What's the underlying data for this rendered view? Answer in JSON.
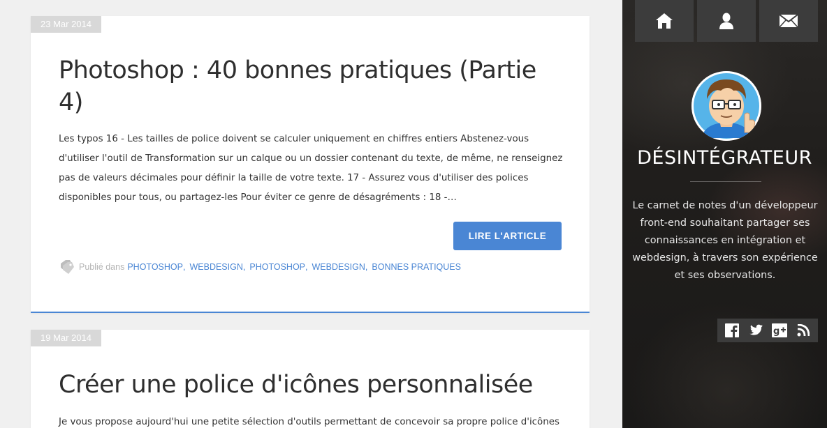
{
  "posts": [
    {
      "date": "23 Mar 2014",
      "title": "Photoshop : 40 bonnes pratiques (Partie 4)",
      "excerpt": "Les typos 16 - Les tailles de police doivent se calculer uniquement en chiffres entiers Abstenez-vous d'utiliser l'outil de Transformation sur un calque ou un dossier contenant du texte, de même, ne renseignez pas de valeurs décimales pour définir la taille de votre texte. 17 - Assurez vous d'utiliser des polices disponibles pour tous, ou partagez-les Pour éviter ce genre de désagréments : 18 -…",
      "read_more_label": "LIRE L'ARTICLE",
      "tags_prefix": "Publié dans",
      "tags": [
        "PHOTOSHOP",
        "WEBDESIGN",
        "PHOTOSHOP",
        "WEBDESIGN",
        "BONNES PRATIQUES"
      ]
    },
    {
      "date": "19 Mar 2014",
      "title": "Créer une police d'icônes personnalisée",
      "excerpt": "Je vous propose aujourd'hui une petite sélection d'outils permettant de concevoir sa propre police d'icônes"
    }
  ],
  "sidebar": {
    "nav": [
      {
        "icon": "home-icon"
      },
      {
        "icon": "user-icon"
      },
      {
        "icon": "mail-icon"
      }
    ],
    "site_title": "DÉSINTÉGRATEUR",
    "tagline": "Le carnet de notes d'un développeur front-end souhaitant partager ses connaissances en intégration et webdesign, à travers son expérience et ses observations.",
    "social": [
      {
        "icon": "facebook-icon"
      },
      {
        "icon": "twitter-icon"
      },
      {
        "icon": "google-plus-icon"
      },
      {
        "icon": "rss-icon"
      }
    ]
  },
  "colors": {
    "accent": "#4a86d4",
    "date_badge": "#d8d8d8",
    "nav_button": "#3c3c3c",
    "page_background": "#f0f0f0"
  }
}
